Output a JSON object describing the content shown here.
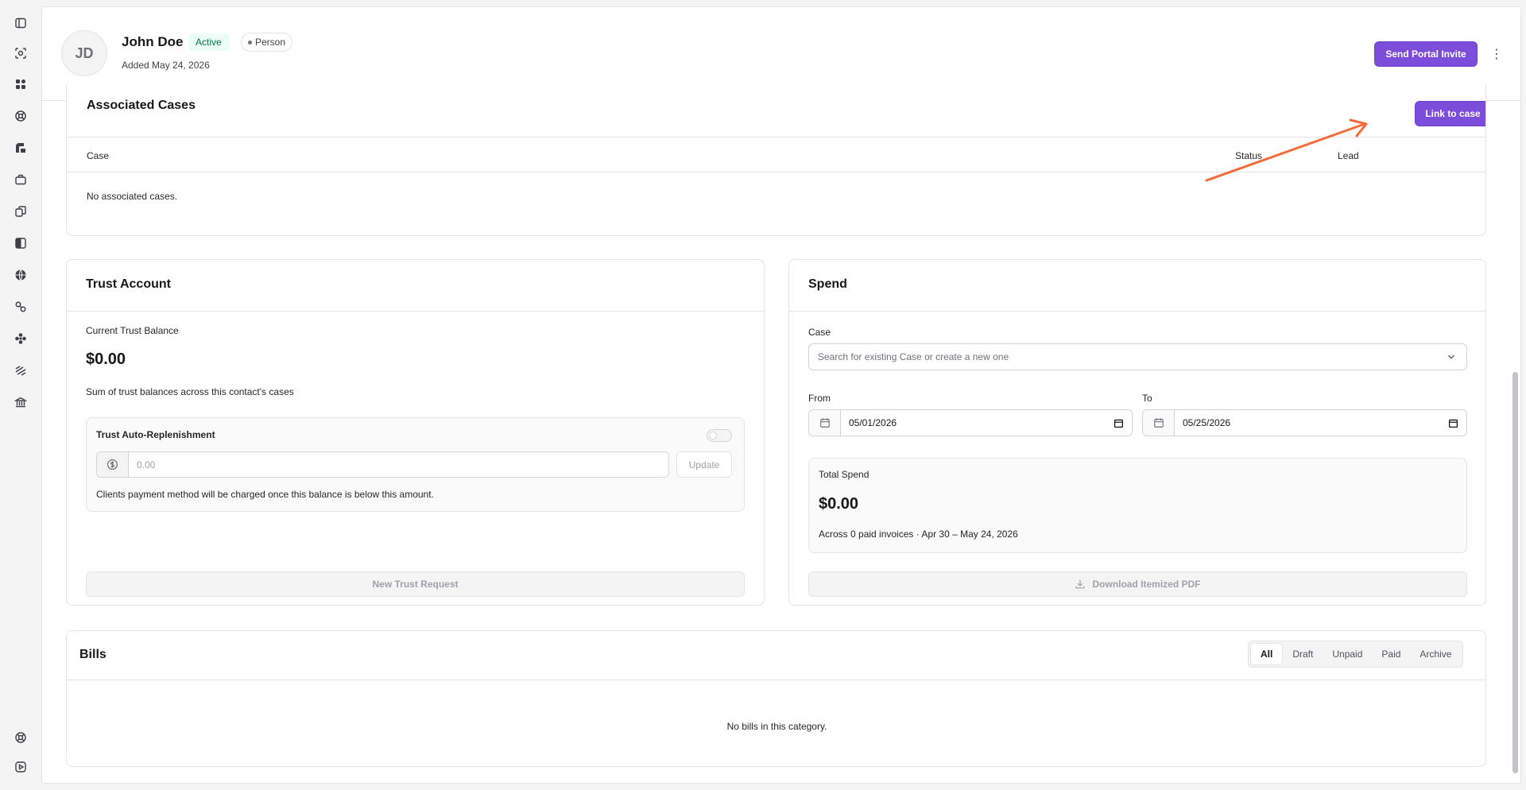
{
  "contact": {
    "initials": "JD",
    "name": "John Doe",
    "status": "Active",
    "type": "Person",
    "added": "Added May 24, 2026"
  },
  "header": {
    "send_invite_label": "Send Portal Invite",
    "more_label": "⋮"
  },
  "associated_cases": {
    "title": "Associated Cases",
    "link_button": "Link to case",
    "columns": [
      "Case",
      "Status",
      "Lead"
    ],
    "empty": "No associated cases."
  },
  "trust": {
    "title": "Trust Account",
    "balance_label": "Current Trust Balance",
    "balance": "$0.00",
    "balance_note": "Sum of trust balances across this contact's cases",
    "auto_title": "Trust Auto-Replenishment",
    "amount_placeholder": "0.00",
    "update_label": "Update",
    "auto_note": "Clients payment method will be charged once this balance is below this amount.",
    "new_request_label": "New Trust Request"
  },
  "spend": {
    "title": "Spend",
    "case_label": "Case",
    "case_placeholder": "Search for existing Case or create a new one",
    "from_label": "From",
    "from_value": "05/01/2026",
    "to_label": "To",
    "to_value": "05/25/2026",
    "total_label": "Total Spend",
    "total_value": "$0.00",
    "total_note": "Across 0 paid invoices · Apr 30 – May 24, 2026",
    "download_label": "Download Itemized PDF"
  },
  "bills": {
    "title": "Bills",
    "tabs": [
      "All",
      "Draft",
      "Unpaid",
      "Paid",
      "Archive"
    ],
    "active_tab": "All",
    "empty": "No bills in this category."
  },
  "colors": {
    "accent": "#7c4ddb",
    "annotation_arrow": "#f26b3a",
    "active_badge_bg": "#ecfdf5",
    "active_badge_text": "#047857"
  },
  "sidebar_icons": [
    "sidebar-toggle-icon",
    "scan-icon",
    "dashboard-icon",
    "support-icon",
    "brand-icon",
    "briefcase-icon",
    "documents-icon",
    "book-icon",
    "globe-icon",
    "link-icon",
    "contacts-icon",
    "billing-icon",
    "bank-icon",
    "help-icon",
    "play-icon"
  ]
}
